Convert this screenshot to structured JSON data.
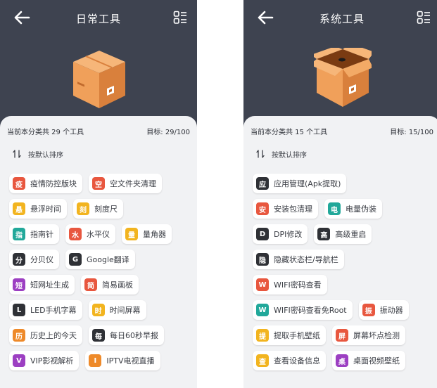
{
  "colors": {
    "background": "#3e4350",
    "panel": "#f1f2f4",
    "badge_red": "#e8573f",
    "badge_yellow": "#f2b41f",
    "badge_teal": "#21a89a",
    "badge_orange": "#ee8a2a",
    "badge_dark": "#2f3136",
    "badge_purple": "#9c3fc2",
    "box_front": "#f0a05a",
    "box_side": "#d9803c",
    "box_top": "#f6b679"
  },
  "left": {
    "title": "日常工具",
    "back_icon": "arrow-left-icon",
    "grid_icon": "grid-list-icon",
    "stats": {
      "count_text": "当前本分类共 29 个工具",
      "target_text": "目标:  29/100"
    },
    "sort_label": "按默认排序",
    "tools": [
      [
        {
          "badge": "疫",
          "label": "疫情防控版块",
          "color": "#e8573f"
        },
        {
          "badge": "空",
          "label": "空文件夹清理",
          "color": "#e8573f"
        }
      ],
      [
        {
          "badge": "悬",
          "label": "悬浮时间",
          "color": "#f2b41f"
        },
        {
          "badge": "刻",
          "label": "刻度尺",
          "color": "#f2b41f"
        }
      ],
      [
        {
          "badge": "指",
          "label": "指南针",
          "color": "#21a89a"
        },
        {
          "badge": "水",
          "label": "水平仪",
          "color": "#e8573f"
        },
        {
          "badge": "量",
          "label": "量角器",
          "color": "#f2b41f"
        }
      ],
      [
        {
          "badge": "分",
          "label": "分贝仪",
          "color": "#2f3136"
        },
        {
          "badge": "G",
          "label": "Google翻译",
          "color": "#2f3136"
        }
      ],
      [
        {
          "badge": "短",
          "label": "短网址生成",
          "color": "#9c3fc2"
        },
        {
          "badge": "简",
          "label": "简易画板",
          "color": "#e8573f"
        }
      ],
      [
        {
          "badge": "L",
          "label": "LED手机字幕",
          "color": "#2f3136"
        },
        {
          "badge": "时",
          "label": "时间屏幕",
          "color": "#f2b41f"
        }
      ],
      [
        {
          "badge": "历",
          "label": "历史上的今天",
          "color": "#ee8a2a"
        },
        {
          "badge": "每",
          "label": "每日60秒早报",
          "color": "#2f3136"
        }
      ],
      [
        {
          "badge": "V",
          "label": "VIP影视解析",
          "color": "#9c3fc2"
        },
        {
          "badge": "I",
          "label": "IPTV电视直播",
          "color": "#ee8a2a"
        }
      ]
    ]
  },
  "right": {
    "title": "系统工具",
    "back_icon": "arrow-left-icon",
    "grid_icon": "grid-list-icon",
    "stats": {
      "count_text": "当前本分类共 15 个工具",
      "target_text": "目标:  15/100"
    },
    "sort_label": "按默认排序",
    "tools": [
      [
        {
          "badge": "应",
          "label": "应用管理(Apk提取)",
          "color": "#2f3136"
        }
      ],
      [
        {
          "badge": "安",
          "label": "安装包清理",
          "color": "#e8573f"
        },
        {
          "badge": "电",
          "label": "电量伪装",
          "color": "#21a89a"
        }
      ],
      [
        {
          "badge": "D",
          "label": "DPI修改",
          "color": "#2f3136"
        },
        {
          "badge": "高",
          "label": "高级重启",
          "color": "#2f3136"
        }
      ],
      [
        {
          "badge": "隐",
          "label": "隐藏状态栏/导航栏",
          "color": "#2f3136"
        }
      ],
      [
        {
          "badge": "W",
          "label": "WIFI密码查看",
          "color": "#e8573f"
        }
      ],
      [
        {
          "badge": "W",
          "label": "WIFI密码查看免Root",
          "color": "#21a89a"
        },
        {
          "badge": "振",
          "label": "振动器",
          "color": "#e8573f"
        }
      ],
      [
        {
          "badge": "提",
          "label": "提取手机壁纸",
          "color": "#f2b41f"
        },
        {
          "badge": "屏",
          "label": "屏幕坏点检测",
          "color": "#e8573f"
        }
      ],
      [
        {
          "badge": "查",
          "label": "查看设备信息",
          "color": "#f2b41f"
        },
        {
          "badge": "桌",
          "label": "桌面视频壁纸",
          "color": "#9c3fc2"
        }
      ]
    ]
  }
}
